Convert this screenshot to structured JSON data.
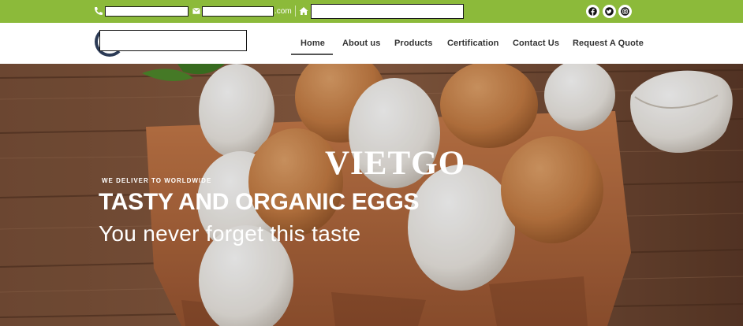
{
  "topbar": {
    "phone_icon": "phone-icon",
    "email_icon": "envelope-icon",
    "email_suffix": ".com",
    "home_icon": "home-icon",
    "social": [
      "facebook-icon",
      "twitter-icon",
      "instagram-icon"
    ],
    "bg_color": "#8cba3a"
  },
  "nav": {
    "items": [
      {
        "label": "Home",
        "active": true
      },
      {
        "label": "About us"
      },
      {
        "label": "Products"
      },
      {
        "label": "Certification"
      },
      {
        "label": "Contact Us"
      },
      {
        "label": "Request A Quote"
      }
    ]
  },
  "hero": {
    "watermark": "VIETGO",
    "kicker": "WE DELIVER TO WORLDWIDE",
    "headline": "TASTY AND ORGANIC EGGS",
    "subline": "You never forget this taste"
  }
}
